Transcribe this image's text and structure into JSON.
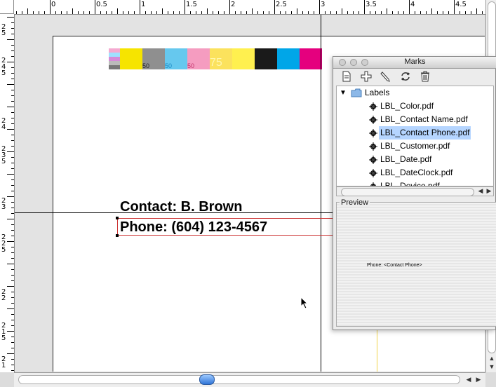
{
  "ruler_top": {
    "labels": [
      "0",
      "0.5",
      "1",
      "1.5",
      "2",
      "2.5",
      "3",
      "3.5",
      "4",
      "4.5"
    ]
  },
  "ruler_left": {
    "labels": [
      "2\n5",
      "2\n4\n5",
      "2\n4",
      "2\n3\n5",
      "2\n3",
      "2\n2\n5",
      "2\n2",
      "2\n1\n5",
      "2\n1"
    ]
  },
  "colorbar": {
    "swatches": [
      {
        "color": "#f6e400",
        "label": ""
      },
      {
        "color": "#8f8f8f",
        "label": "50"
      },
      {
        "color": "#66c8ee",
        "label": "50"
      },
      {
        "color": "#f59cc0",
        "label": "50"
      },
      {
        "color": "#fbe25d",
        "label": "75"
      },
      {
        "color": "#fff04f",
        "label": ""
      },
      {
        "color": "#1a1a1a",
        "label": ""
      },
      {
        "color": "#00a6e8",
        "label": ""
      },
      {
        "color": "#e5007e",
        "label": ""
      }
    ]
  },
  "document": {
    "contact_line": "Contact: B. Brown",
    "phone_line": "Phone: (604) 123-4567"
  },
  "palette": {
    "title": "Marks",
    "folder": "Labels",
    "items": [
      "LBL_Color.pdf",
      "LBL_Contact Name.pdf",
      "LBL_Contact Phone.pdf",
      "LBL_Customer.pdf",
      "LBL_Date.pdf",
      "LBL_DateClock.pdf",
      "LBL_Device.pdf"
    ],
    "selected_item": "LBL_Contact Phone.pdf",
    "preview_label": "Preview",
    "preview_text": "Phone: <Contact Phone>"
  },
  "icons": {
    "new_mark": "new-document-icon",
    "add": "add-icon",
    "edit": "pencil-icon",
    "refresh": "refresh-icon",
    "delete": "trash-icon"
  },
  "colors": {
    "selection": "#b5d5ff",
    "frame_red": "#cc3333",
    "scroll_thumb": "#2f74d6"
  }
}
